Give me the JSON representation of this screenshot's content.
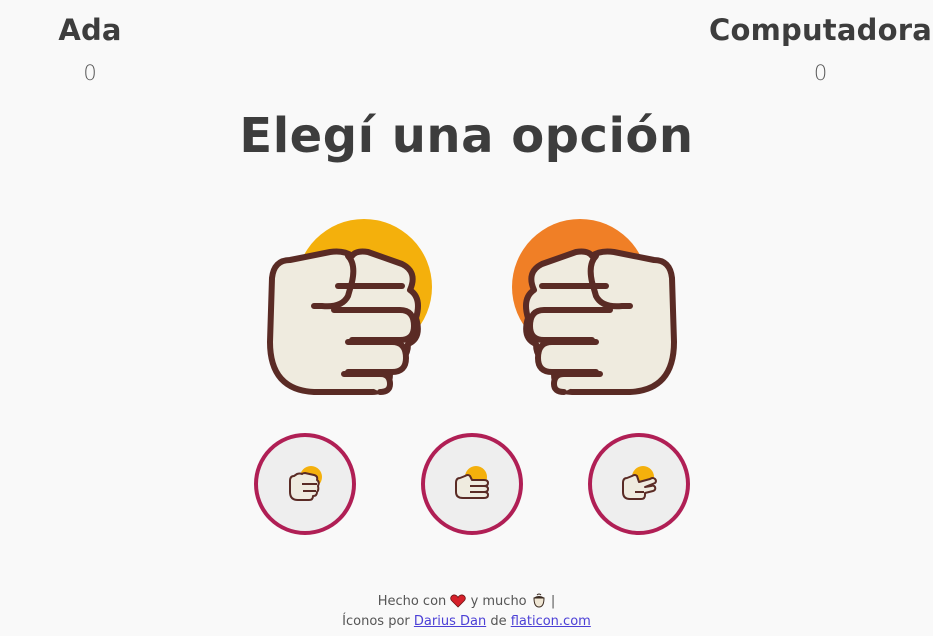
{
  "players": {
    "left": {
      "name": "Ada",
      "score": "0"
    },
    "right": {
      "name": "Computadora",
      "score": "0"
    }
  },
  "headline": "Elegí una opción",
  "big_hands": [
    {
      "icon": "rock-fist-icon",
      "accent": "#f4b00c"
    },
    {
      "icon": "rock-fist-icon",
      "accent": "#f07f26"
    }
  ],
  "options": [
    {
      "icon": "rock-icon"
    },
    {
      "icon": "paper-icon"
    },
    {
      "icon": "scissors-icon"
    }
  ],
  "footer": {
    "made_with": "Hecho con",
    "and_much": "y mucho",
    "separator": "|",
    "icons_by": "Íconos por",
    "author": "Darius Dan",
    "from": "de",
    "site": "flaticon.com",
    "heart_color": "#d6202a"
  },
  "colors": {
    "option_border": "#b01f55",
    "text": "#3d3d3d",
    "link": "#4b3fd6"
  }
}
